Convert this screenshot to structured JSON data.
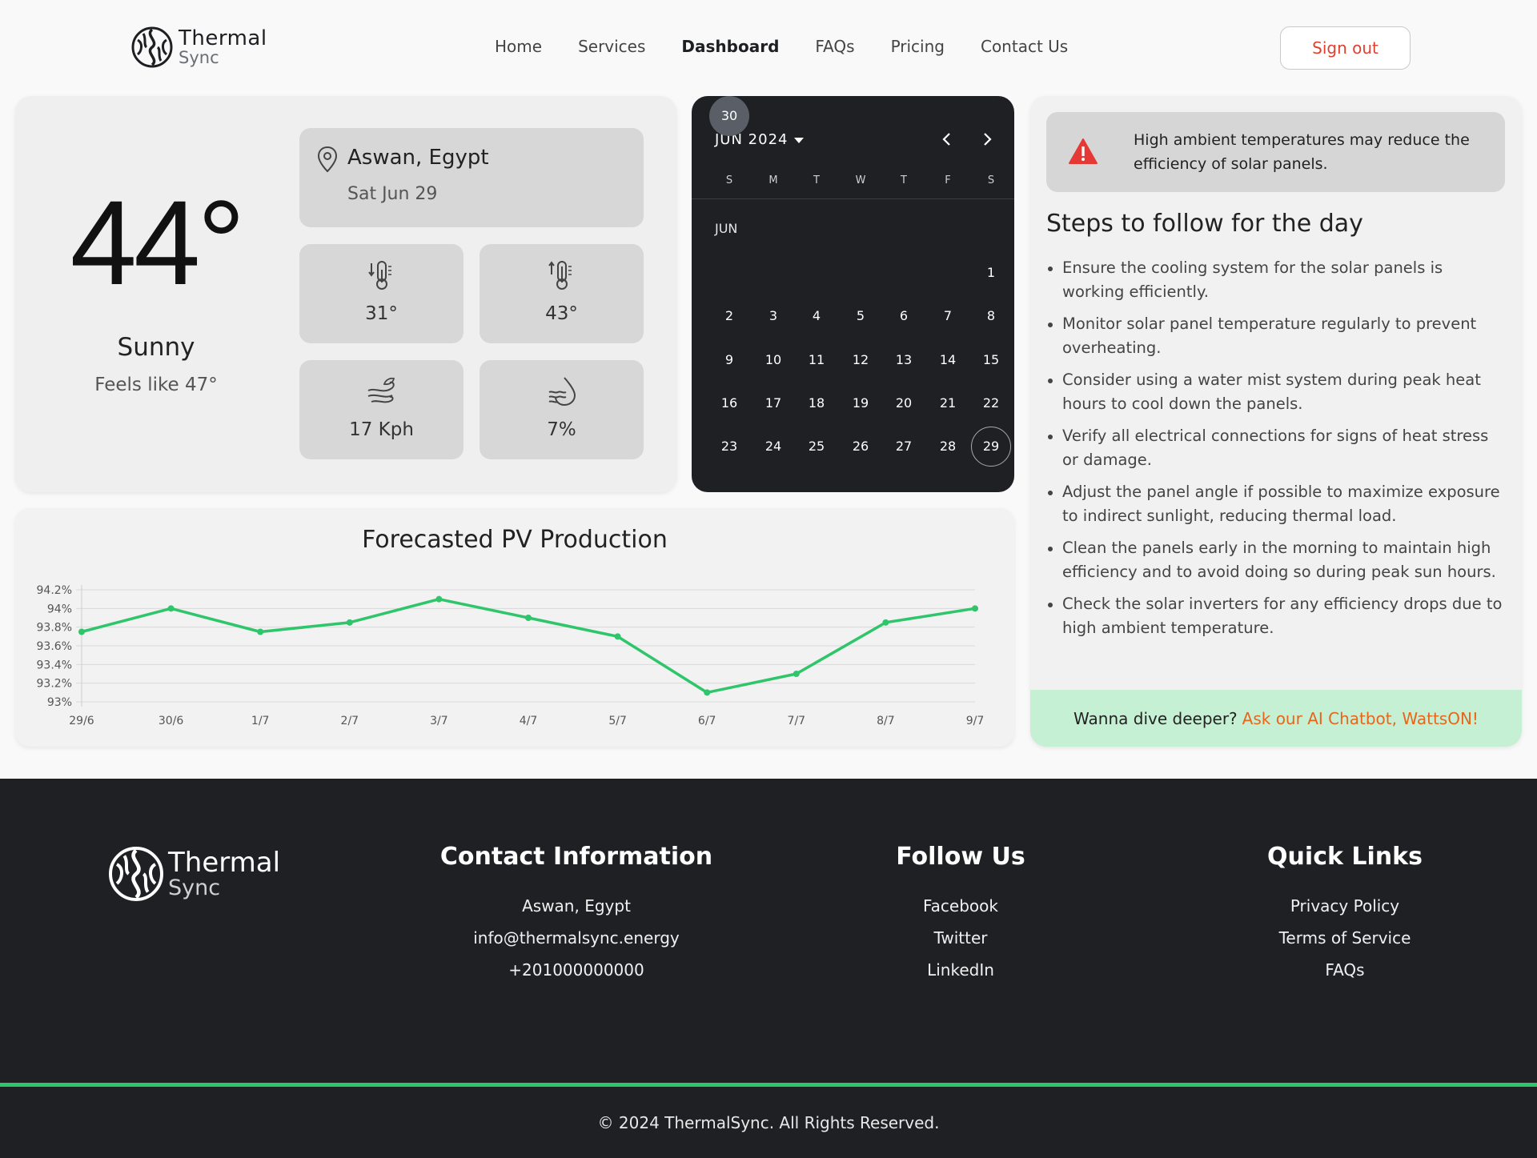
{
  "brand": {
    "name_line1": "Thermal",
    "name_line2": "Sync"
  },
  "nav": {
    "items": [
      "Home",
      "Services",
      "Dashboard",
      "FAQs",
      "Pricing",
      "Contact Us"
    ],
    "active": "Dashboard",
    "sign_out": "Sign out"
  },
  "weather": {
    "temperature": "44°",
    "condition": "Sunny",
    "feels_like": "Feels like 47°",
    "location": "Aswan, Egypt",
    "date": "Sat Jun 29",
    "tiles": [
      {
        "icon": "thermometer-low-icon",
        "value": "31°"
      },
      {
        "icon": "thermometer-high-icon",
        "value": "43°"
      },
      {
        "icon": "wind-icon",
        "value": "17 Kph"
      },
      {
        "icon": "humidity-drop-icon",
        "value": "7%"
      }
    ]
  },
  "calendar": {
    "title": "JUN 2024",
    "month_label": "JUN",
    "weekdays": [
      "S",
      "M",
      "T",
      "W",
      "T",
      "F",
      "S"
    ],
    "first_weekday_index": 6,
    "days_in_month": 30,
    "today": 29,
    "selected": 30
  },
  "chart_data": {
    "type": "line",
    "title": "Forecasted PV Production",
    "categories": [
      "29/6",
      "30/6",
      "1/7",
      "2/7",
      "3/7",
      "4/7",
      "5/7",
      "6/7",
      "7/7",
      "8/7",
      "9/7"
    ],
    "series": [
      {
        "values": [
          93.75,
          94.0,
          93.75,
          93.85,
          94.1,
          93.9,
          93.7,
          93.1,
          93.3,
          93.85,
          94.0
        ]
      }
    ],
    "y_ticks": [
      "93%",
      "93.2%",
      "93.4%",
      "93.6%",
      "93.8%",
      "94%",
      "94.2%"
    ],
    "ylim": [
      93.0,
      94.2
    ],
    "grid": true,
    "color": "#2fc56a"
  },
  "advice": {
    "alert": "High ambient temperatures may reduce the efficiency of solar panels.",
    "steps_title": "Steps to follow for the day",
    "steps": [
      "Ensure the cooling system for the solar panels is working efficiently.",
      "Monitor solar panel temperature regularly to prevent overheating.",
      "Consider using a water mist system during peak heat hours to cool down the panels.",
      "Verify all electrical connections for signs of heat stress or damage.",
      "Adjust the panel angle if possible to maximize exposure to indirect sunlight, reducing thermal load.",
      "Clean the panels early in the morning to maintain high efficiency and to avoid doing so during peak sun hours.",
      "Check the solar inverters for any efficiency drops due to high ambient temperature."
    ],
    "cta_text": "Wanna dive deeper?",
    "cta_link": "Ask our AI Chatbot, WattsON!"
  },
  "footer": {
    "contact": {
      "title": "Contact Information",
      "lines": [
        "Aswan, Egypt",
        "info@thermalsync.energy",
        "+201000000000"
      ]
    },
    "follow": {
      "title": "Follow Us",
      "links": [
        "Facebook",
        "Twitter",
        "LinkedIn"
      ]
    },
    "quick": {
      "title": "Quick Links",
      "links": [
        "Privacy Policy",
        "Terms of Service",
        "FAQs"
      ]
    },
    "copyright": "© 2024 ThermalSync. All Rights Reserved."
  },
  "colors": {
    "accent": "#2fc56a",
    "danger": "#e53935",
    "cta_link": "#e8651a",
    "dark": "#1e2023"
  }
}
